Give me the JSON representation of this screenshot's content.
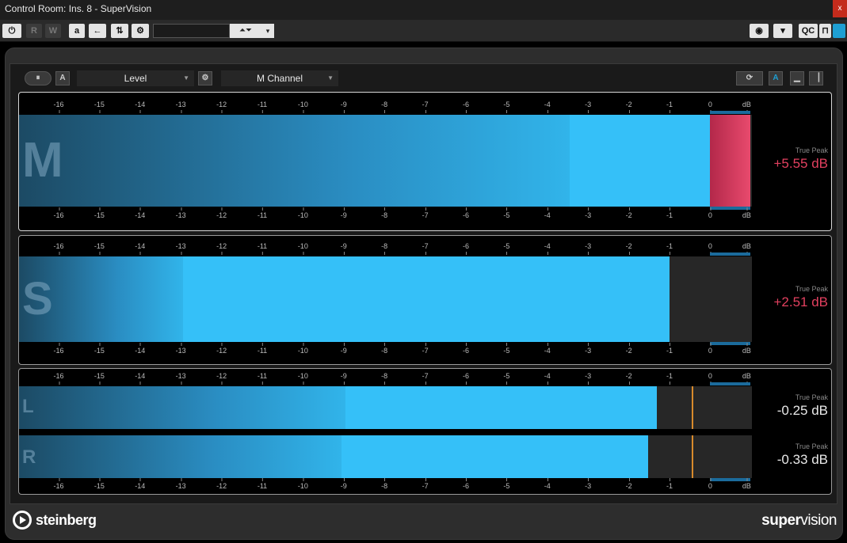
{
  "window": {
    "title": "Control Room: Ins. 8 - SuperVision",
    "close_label": "x"
  },
  "toolbar": {
    "read_label": "R",
    "write_label": "W",
    "auto_label": "a",
    "preset_value": "",
    "qc_label": "QC",
    "arrows_glyph": "⏶⏷",
    "dropdown_glyph": "▾"
  },
  "panel": {
    "module_label": "Level",
    "channel_label": "M Channel",
    "a_label": "A",
    "a_right_label": "A"
  },
  "scale_labels": [
    "-16",
    "-15",
    "-14",
    "-13",
    "-12",
    "-11",
    "-10",
    "-9",
    "-8",
    "-7",
    "-6",
    "-5",
    "-4",
    "-3",
    "-2",
    "-1",
    "0",
    "dB"
  ],
  "meters": [
    {
      "channel": "M",
      "level_db": -3.45,
      "peak_db": 0,
      "over": true,
      "readout_label": "True Peak",
      "readout_value": "+5.55 dB",
      "readout_color": "#e2405f"
    },
    {
      "channel": "S",
      "level_db": -12.95,
      "peak_db": -1.0,
      "over": false,
      "readout_label": "True Peak",
      "readout_value": "+2.51 dB",
      "readout_color": "#e2405f"
    },
    {
      "channel": "L",
      "level_db": -8.95,
      "peak_db": -1.32,
      "peak_line_db": -0.45,
      "over": false,
      "readout_label": "True Peak",
      "readout_value": "-0.25 dB",
      "readout_color": "#e8e8e8"
    },
    {
      "channel": "R",
      "level_db": -9.05,
      "peak_db": -1.52,
      "peak_line_db": -0.45,
      "over": false,
      "readout_label": "True Peak",
      "readout_value": "-0.33 dB",
      "readout_color": "#e8e8e8"
    }
  ],
  "footer": {
    "brand": "steinberg",
    "product_bold": "super",
    "product_rest": "vision"
  },
  "colors": {
    "accent": "#1e9fd3",
    "over": "#e84a6d",
    "meter_peak": "#35c0f8"
  }
}
